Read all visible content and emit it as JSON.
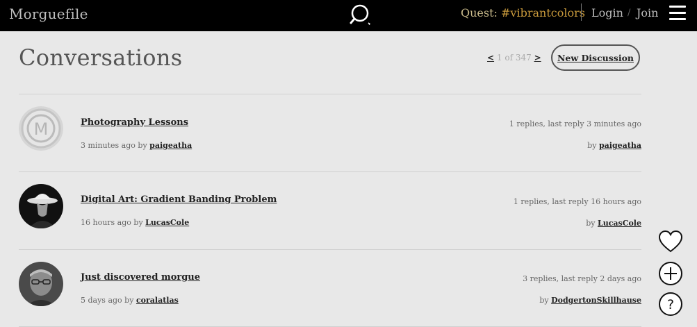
{
  "header": {
    "brand": "Morguefile",
    "quest_label": "Quest:",
    "quest_tag": "#vibrantcolors",
    "login": "Login",
    "separator": "/",
    "join": "Join"
  },
  "main": {
    "title": "Conversations",
    "pager": {
      "prev": "<",
      "status": "1 of 347",
      "next": ">"
    },
    "new_discussion": "New Discussion"
  },
  "threads": [
    {
      "title": "Photography Lessons",
      "posted": "3 minutes ago by",
      "author": "paigeatha",
      "replies": "1 replies, last reply 3 minutes ago",
      "by_label": "by",
      "last_user": "paigeatha",
      "avatar": "default-m-avatar"
    },
    {
      "title": "Digital Art: Gradient Banding Problem",
      "posted": "16 hours ago by",
      "author": "LucasCole",
      "replies": "1 replies, last reply 16 hours ago",
      "by_label": "by",
      "last_user": "LucasCole",
      "avatar": "hat-silhouette-avatar"
    },
    {
      "title": "Just discovered morgue",
      "posted": "5 days ago by",
      "author": "coralatlas",
      "replies": "3 replies, last reply 2 days ago",
      "by_label": "by",
      "last_user": "DodgertonSkillhause",
      "avatar": "man-glasses-avatar"
    }
  ],
  "side_actions": [
    {
      "icon": "heart-icon"
    },
    {
      "icon": "plus-circle-icon"
    },
    {
      "icon": "question-circle-icon"
    }
  ]
}
